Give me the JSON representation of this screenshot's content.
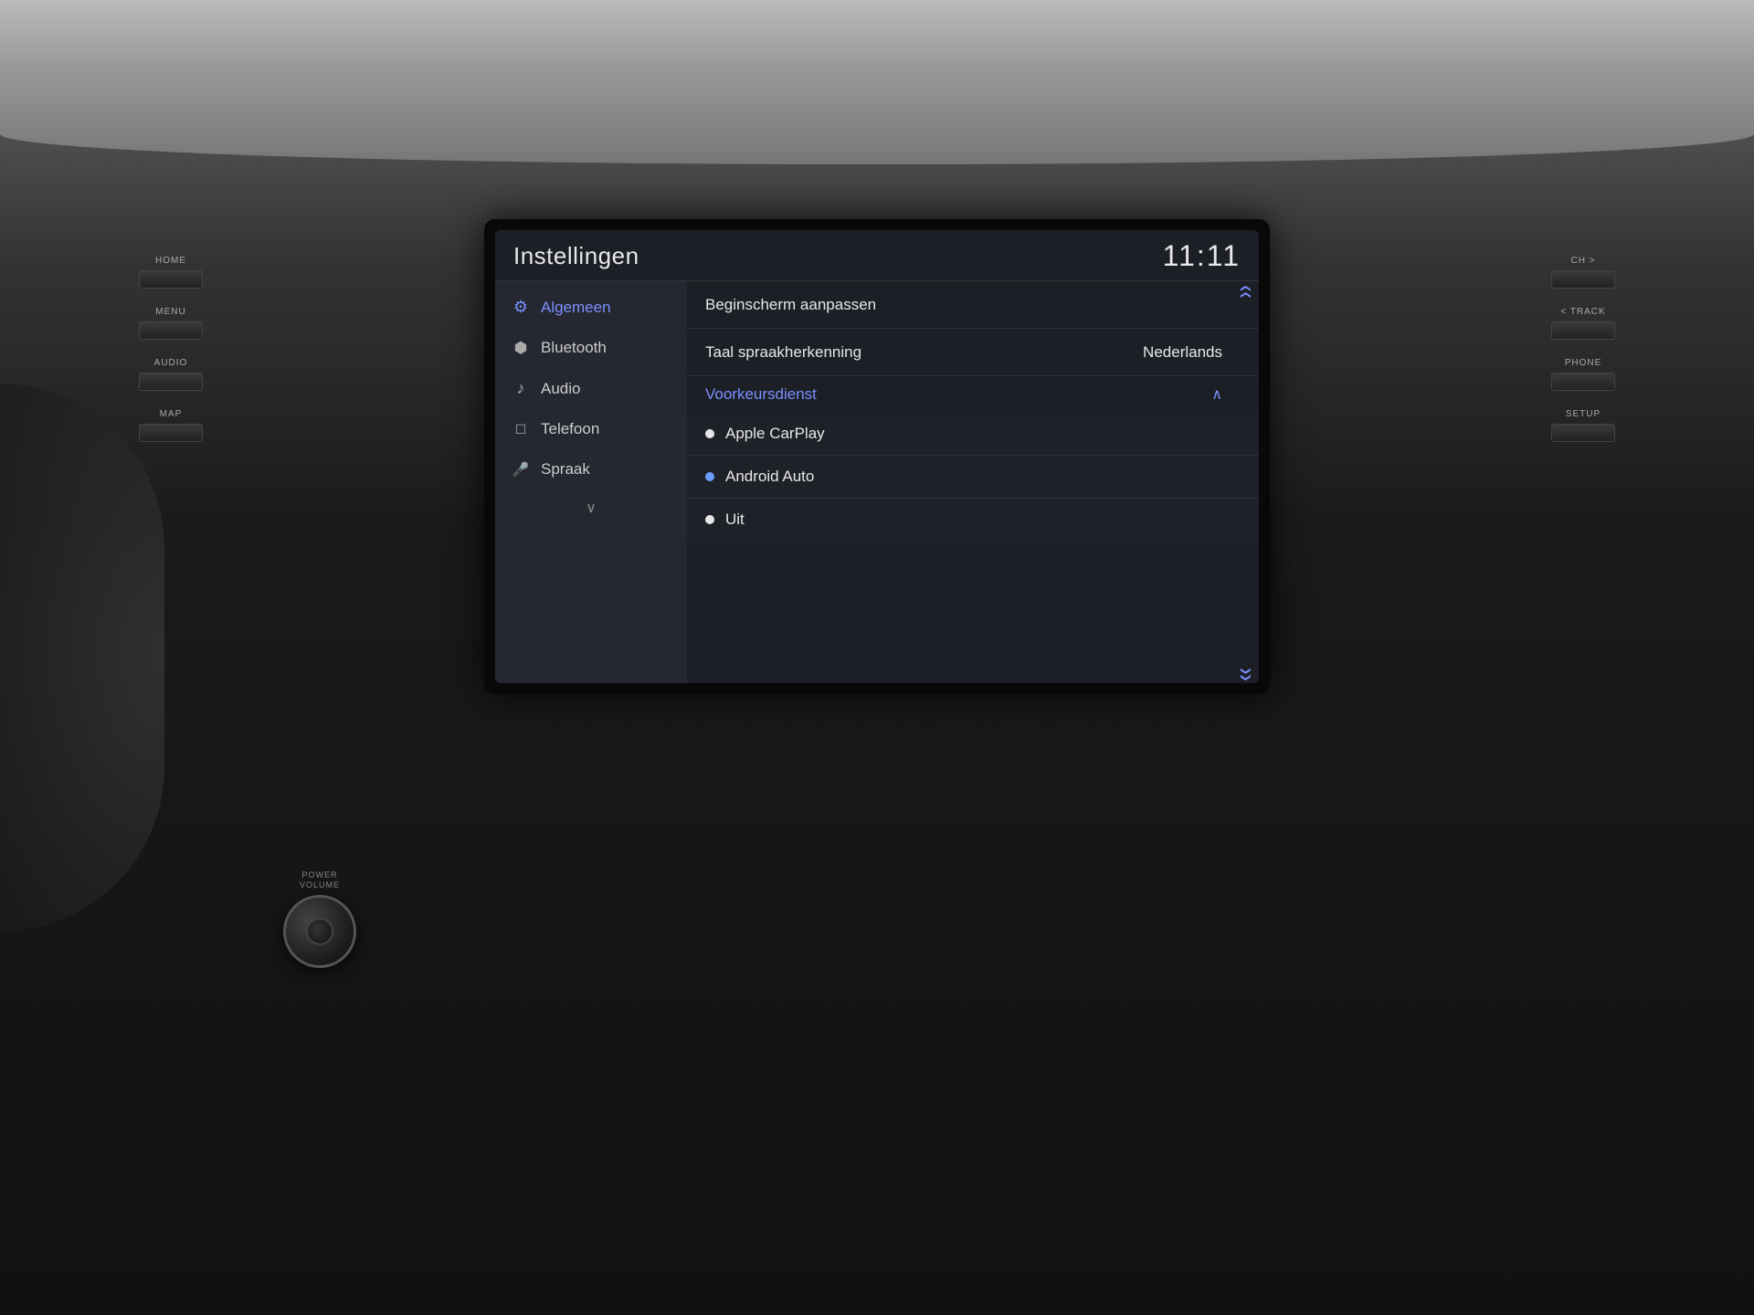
{
  "screen": {
    "title": "Instellingen",
    "time": "11:11"
  },
  "sidebar": {
    "items": [
      {
        "id": "algemeen",
        "label": "Algemeen",
        "icon": "⚙",
        "active": true
      },
      {
        "id": "bluetooth",
        "label": "Bluetooth",
        "icon": "𝔅",
        "active": false
      },
      {
        "id": "audio",
        "label": "Audio",
        "icon": "♪",
        "active": false
      },
      {
        "id": "telefoon",
        "label": "Telefoon",
        "icon": "📱",
        "active": false
      },
      {
        "id": "spraak",
        "label": "Spraak",
        "icon": "🎤",
        "active": false
      }
    ],
    "more_label": "∨"
  },
  "content": {
    "items": [
      {
        "id": "beginscherm",
        "label": "Beginscherm aanpassen",
        "value": ""
      },
      {
        "id": "taal",
        "label": "Taal spraakherkenning",
        "value": "Nederlands"
      }
    ],
    "section": {
      "label": "Voorkeursdienst",
      "collapse_icon": "∧"
    },
    "radio_items": [
      {
        "id": "apple",
        "label": "Apple CarPlay",
        "dot_color": "white"
      },
      {
        "id": "android",
        "label": "Android Auto",
        "dot_color": "blue"
      },
      {
        "id": "uit",
        "label": "Uit",
        "dot_color": "white"
      }
    ]
  },
  "buttons": {
    "left": [
      {
        "id": "home",
        "label": "HOME"
      },
      {
        "id": "menu",
        "label": "MENU"
      },
      {
        "id": "audio",
        "label": "AUDIO"
      },
      {
        "id": "map",
        "label": "MAP"
      },
      {
        "id": "power_volume",
        "label": "POWER\nVOLUME"
      }
    ],
    "right": [
      {
        "id": "ch",
        "label": "CH >"
      },
      {
        "id": "track",
        "label": "< TRACK"
      },
      {
        "id": "phone",
        "label": "PHONE"
      },
      {
        "id": "setup",
        "label": "SETUP"
      }
    ]
  },
  "colors": {
    "active_blue": "#7b8fff",
    "screen_bg": "#1c1f26",
    "sidebar_bg": "#252830",
    "text_main": "#e8e8e8",
    "text_muted": "#888"
  }
}
